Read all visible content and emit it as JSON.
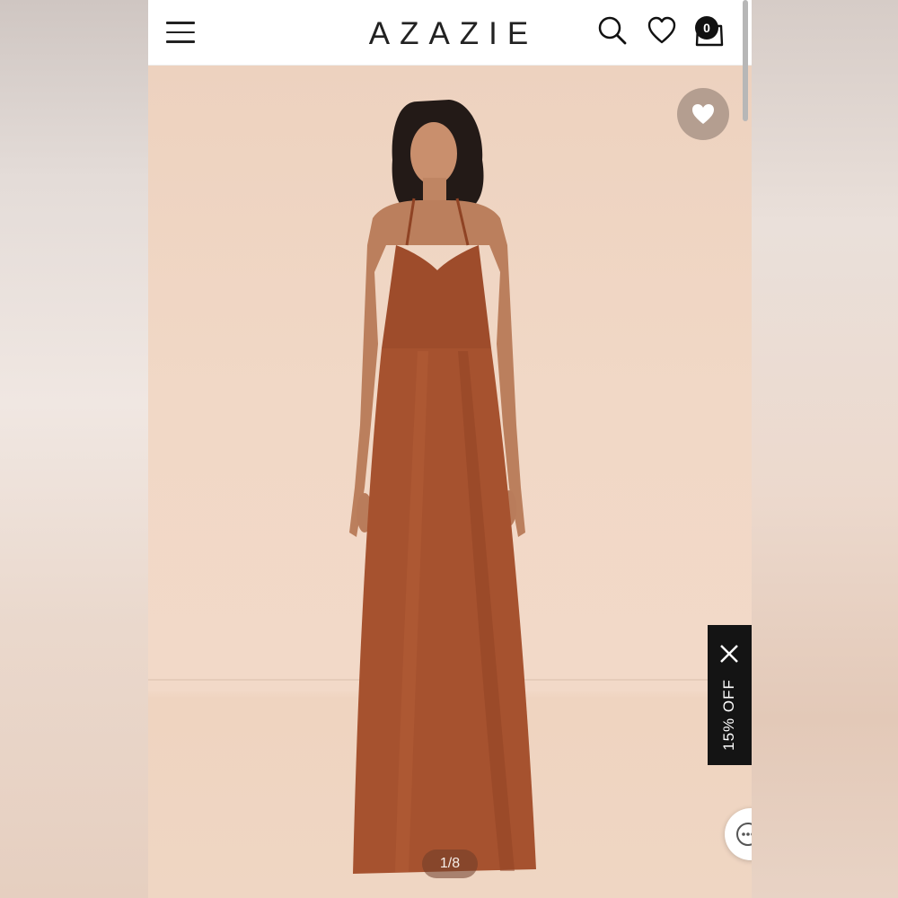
{
  "header": {
    "logo": "AZAZIE",
    "cart_count": "0",
    "icons": [
      "hamburger-menu-icon",
      "search-icon",
      "heart-icon",
      "shopping-bag-icon"
    ]
  },
  "gallery": {
    "page_indicator": "1/8",
    "wishlist_icon": "heart-icon"
  },
  "promo": {
    "label": "15% OFF",
    "close_icon": "close-icon"
  },
  "chat": {
    "icon": "chat-icon"
  },
  "colors": {
    "header_bg": "#ffffff",
    "text": "#222222",
    "dress": "#a6522f",
    "backdrop": "#f0d8c7",
    "promo_bg": "#141414"
  }
}
